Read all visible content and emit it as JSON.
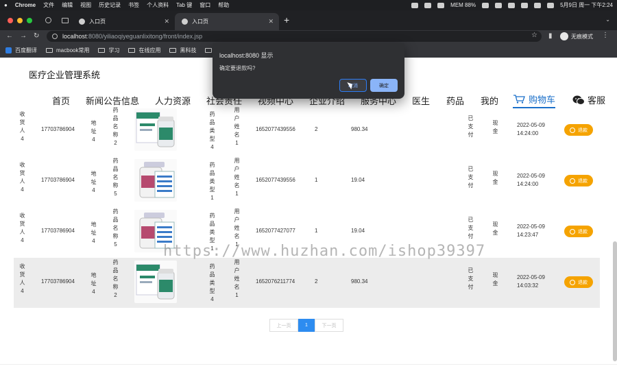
{
  "menubar": {
    "apple": "",
    "items": [
      "Chrome",
      "文件",
      "编辑",
      "视图",
      "历史记录",
      "书签",
      "个人资料",
      "Tab 键",
      "窗口",
      "帮助"
    ],
    "status_mem": "MEM 88%",
    "clock": "5月9日 周一 下午2:24"
  },
  "tabs": [
    {
      "title": "入口页"
    },
    {
      "title": "入口页"
    }
  ],
  "address": {
    "host": "localhost",
    "path": ":8080/yiliaoqiyeguanlixitong/front/index.jsp",
    "incognito": "无痕模式"
  },
  "bookmarks": [
    {
      "label": "百度翻译",
      "kind": "fav"
    },
    {
      "label": "macbook常用",
      "kind": "folder"
    },
    {
      "label": "学习",
      "kind": "folder"
    },
    {
      "label": "在线应用",
      "kind": "folder"
    },
    {
      "label": "黑科技",
      "kind": "folder"
    },
    {
      "label": "临时",
      "kind": "folder"
    }
  ],
  "site": {
    "title": "医疗企业管理系统"
  },
  "nav": {
    "home": "首页",
    "news": "新闻公告信息",
    "hr": "人力资源",
    "social": "社会责任",
    "video": "视频中心",
    "intro": "企业介绍",
    "service": "服务中心",
    "doctor": "医生",
    "drug": "药品",
    "mine": "我的",
    "cart": "购物车",
    "kefu": "客服"
  },
  "orders": [
    {
      "receiver": "收货人4",
      "phone": "17703786904",
      "address": "地址4",
      "drug_name": "药品名称2",
      "drug_type": "药品类型4",
      "user": "用户姓名1",
      "order_no": "1652077439556",
      "qty": "2",
      "amount": "980.34",
      "status": "已支付",
      "pay": "现金",
      "date": "2022-05-09",
      "time": "14:24:00",
      "action": "退款",
      "img": "box"
    },
    {
      "receiver": "收货人4",
      "phone": "17703786904",
      "address": "地址4",
      "drug_name": "药品名称5",
      "drug_type": "药品类型1",
      "user": "用户姓名1",
      "order_no": "1652077439556",
      "qty": "1",
      "amount": "19.04",
      "status": "已支付",
      "pay": "现金",
      "date": "2022-05-09",
      "time": "14:24:00",
      "action": "退款",
      "img": "bottle"
    },
    {
      "receiver": "收货人4",
      "phone": "17703786904",
      "address": "地址4",
      "drug_name": "药品名称5",
      "drug_type": "药品类型1",
      "user": "用户姓名1",
      "order_no": "1652077427077",
      "qty": "1",
      "amount": "19.04",
      "status": "已支付",
      "pay": "现金",
      "date": "2022-05-09",
      "time": "14:23:47",
      "action": "退款",
      "img": "bottle"
    },
    {
      "receiver": "收货人4",
      "phone": "17703786904",
      "address": "地址4",
      "drug_name": "药品名称2",
      "drug_type": "药品类型4",
      "user": "用户姓名1",
      "order_no": "1652076211774",
      "qty": "2",
      "amount": "980.34",
      "status": "已支付",
      "pay": "现金",
      "date": "2022-05-09",
      "time": "14:03:32",
      "action": "退款",
      "img": "box"
    }
  ],
  "pager": {
    "prev": "上一页",
    "current": "1",
    "next": "下一页"
  },
  "dialog": {
    "title": "localhost:8080 显示",
    "message": "确定要退款吗?",
    "cancel": "取消",
    "ok": "确定"
  },
  "watermark": "https://www.huzhan.com/ishop39397"
}
